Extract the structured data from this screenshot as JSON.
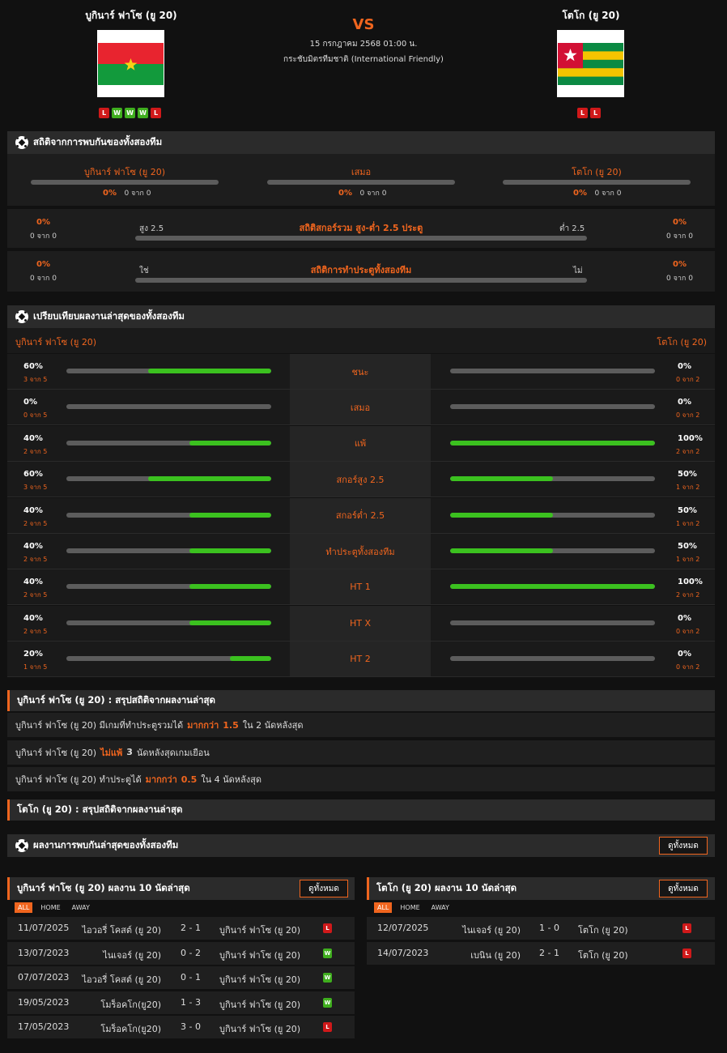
{
  "match": {
    "home_name": "บูกินาร์ ฟาโซ (ยู 20)",
    "away_name": "โตโก (ยู 20)",
    "vs": "VS",
    "date": "15 กรกฎาคม 2568 01:00 น.",
    "league": "กระชับมิตรทีมชาติ (International Friendly)",
    "home_form": [
      "L",
      "W",
      "W",
      "W",
      "L"
    ],
    "away_form": [
      "L",
      "L"
    ]
  },
  "h2h": {
    "title": "สถิติจากการพบกันของทั้งสองทีม",
    "home_label": "บูกินาร์ ฟาโซ (ยู 20)",
    "draw_label": "เสมอ",
    "away_label": "โตโก (ยู 20)",
    "home_pct": "0%",
    "home_sub": "0 จาก 0",
    "draw_pct": "0%",
    "draw_sub": "0 จาก 0",
    "away_pct": "0%",
    "away_sub": "0 จาก 0",
    "ou_title": "สถิติสกอร์รวม สูง-ต่ำ 2.5 ประตู",
    "ou_left_label": "สูง 2.5",
    "ou_right_label": "ต่ำ 2.5",
    "ou_left_pct": "0%",
    "ou_left_sub": "0 จาก 0",
    "ou_right_pct": "0%",
    "ou_right_sub": "0 จาก 0",
    "btts_title": "สถิติการทำประตูทั้งสองทีม",
    "btts_left_label": "ใช่",
    "btts_right_label": "ไม่",
    "btts_left_pct": "0%",
    "btts_left_sub": "0 จาก 0",
    "btts_right_pct": "0%",
    "btts_right_sub": "0 จาก 0"
  },
  "compare": {
    "title": "เปรียบเทียบผลงานล่าสุดของทั้งสองทีม",
    "home_label": "บูกินาร์ ฟาโซ (ยู 20)",
    "away_label": "โตโก (ยู 20)",
    "rows": [
      {
        "label": "ชนะ",
        "lp": "60%",
        "ls": "3 จาก 5",
        "lf": 0.6,
        "rp": "0%",
        "rs": "0 จาก 2",
        "rf": 0
      },
      {
        "label": "เสมอ",
        "lp": "0%",
        "ls": "0 จาก 5",
        "lf": 0,
        "rp": "0%",
        "rs": "0 จาก 2",
        "rf": 0
      },
      {
        "label": "แพ้",
        "lp": "40%",
        "ls": "2 จาก 5",
        "lf": 0.4,
        "rp": "100%",
        "rs": "2 จาก 2",
        "rf": 1
      },
      {
        "label": "สกอร์สูง 2.5",
        "lp": "60%",
        "ls": "3 จาก 5",
        "lf": 0.6,
        "rp": "50%",
        "rs": "1 จาก 2",
        "rf": 0.5
      },
      {
        "label": "สกอร์ต่ำ 2.5",
        "lp": "40%",
        "ls": "2 จาก 5",
        "lf": 0.4,
        "rp": "50%",
        "rs": "1 จาก 2",
        "rf": 0.5
      },
      {
        "label": "ทำประตูทั้งสองทีม",
        "lp": "40%",
        "ls": "2 จาก 5",
        "lf": 0.4,
        "rp": "50%",
        "rs": "1 จาก 2",
        "rf": 0.5
      },
      {
        "label": "HT 1",
        "lp": "40%",
        "ls": "2 จาก 5",
        "lf": 0.4,
        "rp": "100%",
        "rs": "2 จาก 2",
        "rf": 1
      },
      {
        "label": "HT X",
        "lp": "40%",
        "ls": "2 จาก 5",
        "lf": 0.4,
        "rp": "0%",
        "rs": "0 จาก 2",
        "rf": 0
      },
      {
        "label": "HT 2",
        "lp": "20%",
        "ls": "1 จาก 5",
        "lf": 0.2,
        "rp": "0%",
        "rs": "0 จาก 2",
        "rf": 0
      }
    ]
  },
  "summary_home": {
    "title": "บูกินาร์ ฟาโซ (ยู 20) : สรุปสถิติจากผลงานล่าสุด",
    "lines": [
      {
        "a": "บูกินาร์ ฟาโซ (ยู 20) มีเกมที่ทำประตูรวมได้",
        "b": "มากกว่า",
        "c": "1.5",
        "d": "ใน 2 นัดหลังสุด"
      },
      {
        "a": "บูกินาร์ ฟาโซ (ยู 20)",
        "b": "ไม่แพ้",
        "c": "3",
        "d": "นัดหลังสุดเกมเยือน"
      },
      {
        "a": "บูกินาร์ ฟาโซ (ยู 20) ทำประตูได้",
        "b": "มากกว่า",
        "c": "0.5",
        "d": "ใน 4 นัดหลังสุด"
      }
    ]
  },
  "summary_away": {
    "title": "โตโก (ยู 20) : สรุปสถิติจากผลงานล่าสุด"
  },
  "recent": {
    "title": "ผลงานการพบกันล่าสุดของทั้งสองทีม",
    "view_all": "ดูทั้งหมด",
    "home_title": "บูกินาร์ ฟาโซ (ยู 20) ผลงาน 10 นัดล่าสุด",
    "away_title": "โตโก (ยู 20) ผลงาน 10 นัดล่าสุด",
    "tabs": [
      "ALL",
      "HOME",
      "AWAY"
    ],
    "home_rows": [
      {
        "date": "11/07/2025",
        "home": "ไอวอรี่ โคสต์ (ยู 20)",
        "score": "2 - 1",
        "away": "บูกินาร์ ฟาโซ (ยู 20)",
        "res": "L"
      },
      {
        "date": "13/07/2023",
        "home": "ไนเจอร์ (ยู 20)",
        "score": "0 - 2",
        "away": "บูกินาร์ ฟาโซ (ยู 20)",
        "res": "W"
      },
      {
        "date": "07/07/2023",
        "home": "ไอวอรี่ โคสต์ (ยู 20)",
        "score": "0 - 1",
        "away": "บูกินาร์ ฟาโซ (ยู 20)",
        "res": "W"
      },
      {
        "date": "19/05/2023",
        "home": "โมร็อคโก(ยู20)",
        "score": "1 - 3",
        "away": "บูกินาร์ ฟาโซ (ยู 20)",
        "res": "W"
      },
      {
        "date": "17/05/2023",
        "home": "โมร็อคโก(ยู20)",
        "score": "3 - 0",
        "away": "บูกินาร์ ฟาโซ (ยู 20)",
        "res": "L"
      }
    ],
    "away_rows": [
      {
        "date": "12/07/2025",
        "home": "ไนเจอร์ (ยู 20)",
        "score": "1 - 0",
        "away": "โตโก (ยู 20)",
        "res": "L"
      },
      {
        "date": "14/07/2023",
        "home": "เบนิน (ยู 20)",
        "score": "2 - 1",
        "away": "โตโก (ยู 20)",
        "res": "L"
      }
    ]
  },
  "colors": {
    "accent": "#f0651e",
    "win": "#3fae1e",
    "loss": "#d0191a",
    "bar_fill": "#3bc11f",
    "bar_bg": "#5c5c5c"
  },
  "icons": {
    "section": "soccer-ball-icon"
  }
}
